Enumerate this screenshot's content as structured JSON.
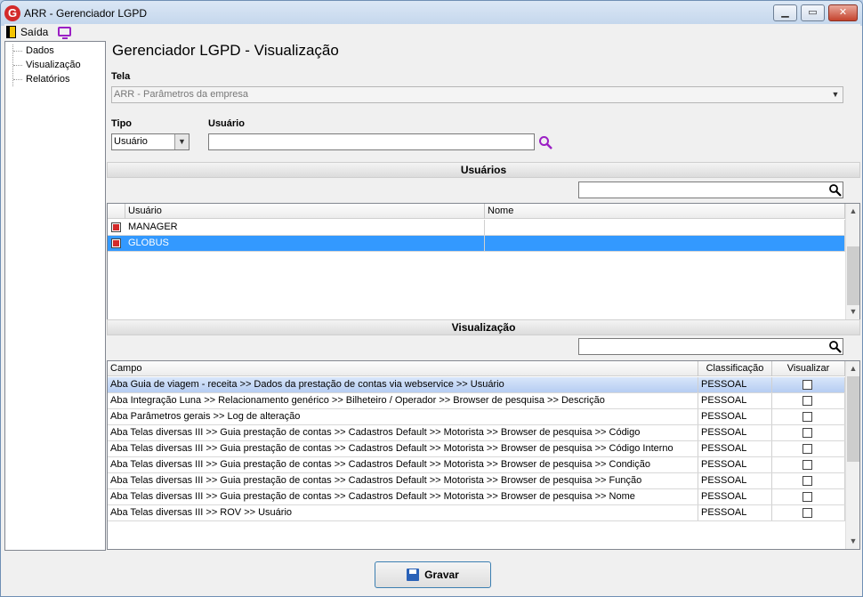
{
  "window": {
    "title": "ARR - Gerenciador LGPD",
    "logo_letter": "G",
    "controls": {
      "minimize": "▁",
      "restore": "▭",
      "close": "✕"
    }
  },
  "menu": {
    "exit_label": "Saída",
    "icons": [
      "exit-door-icon",
      "monitor-icon"
    ]
  },
  "sidebar": {
    "items": [
      {
        "label": "Dados"
      },
      {
        "label": "Visualização"
      },
      {
        "label": "Relatórios"
      }
    ]
  },
  "page_title": "Gerenciador LGPD - Visualização",
  "tela": {
    "label": "Tela",
    "value": "ARR - Parâmetros da empresa"
  },
  "tipo": {
    "label": "Tipo",
    "value": "Usuário"
  },
  "usuario": {
    "label": "Usuário",
    "value": ""
  },
  "users_section": {
    "title": "Usuários",
    "filter_value": "",
    "columns": [
      "Usuário",
      "Nome"
    ],
    "rows": [
      {
        "checked": true,
        "usuario": "MANAGER",
        "nome": "",
        "selected": false
      },
      {
        "checked": true,
        "usuario": "GLOBUS",
        "nome": "",
        "selected": true
      }
    ]
  },
  "view_section": {
    "title": "Visualização",
    "filter_value": "",
    "columns": [
      "Campo",
      "Classificação",
      "Visualizar"
    ],
    "rows": [
      {
        "campo": "Aba Guia de viagem - receita >> Dados da prestação de contas via webservice >> Usuário",
        "classificacao": "PESSOAL",
        "visualizar": false
      },
      {
        "campo": "Aba Integração Luna >> Relacionamento genérico >> Bilheteiro / Operador >> Browser de pesquisa >> Descrição",
        "classificacao": "PESSOAL",
        "visualizar": false
      },
      {
        "campo": "Aba Parâmetros gerais >> Log de alteração",
        "classificacao": "PESSOAL",
        "visualizar": false
      },
      {
        "campo": "Aba Telas diversas III >> Guia prestação de contas >> Cadastros Default >> Motorista >> Browser de pesquisa >> Código",
        "classificacao": "PESSOAL",
        "visualizar": false
      },
      {
        "campo": "Aba Telas diversas III >> Guia prestação de contas >> Cadastros Default >> Motorista >> Browser de pesquisa >> Código Interno",
        "classificacao": "PESSOAL",
        "visualizar": false
      },
      {
        "campo": "Aba Telas diversas III >> Guia prestação de contas >> Cadastros Default >> Motorista >> Browser de pesquisa >> Condição",
        "classificacao": "PESSOAL",
        "visualizar": false
      },
      {
        "campo": "Aba Telas diversas III >> Guia prestação de contas >> Cadastros Default >> Motorista >> Browser de pesquisa >> Função",
        "classificacao": "PESSOAL",
        "visualizar": false
      },
      {
        "campo": "Aba Telas diversas III >> Guia prestação de contas >> Cadastros Default >> Motorista >> Browser de pesquisa >> Nome",
        "classificacao": "PESSOAL",
        "visualizar": false
      },
      {
        "campo": "Aba Telas diversas III >> ROV >> Usuário",
        "classificacao": "PESSOAL",
        "visualizar": false
      }
    ]
  },
  "save_button": {
    "label": "Gravar"
  },
  "colors": {
    "accent": "#3399ff",
    "highlight": "#c6d9f6",
    "check": "#d32a2a",
    "search": "#9b1fc4"
  }
}
